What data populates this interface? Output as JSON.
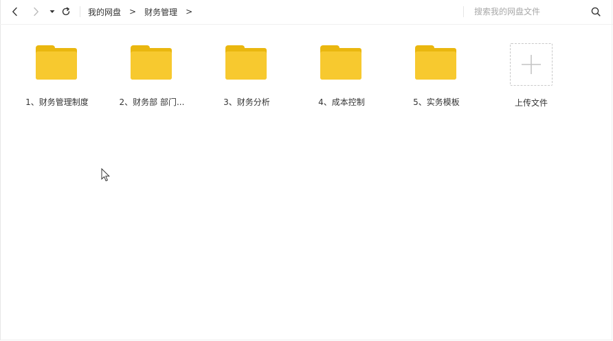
{
  "toolbar": {
    "icons": {
      "back": "chevron-left-icon",
      "forward": "chevron-right-icon",
      "dropdown": "caret-down-icon",
      "refresh": "refresh-icon",
      "search": "search-icon"
    },
    "breadcrumb": [
      {
        "label": "我的网盘"
      },
      {
        "label": "财务管理"
      }
    ],
    "breadcrumb_separator": ">",
    "search": {
      "placeholder": "搜索我的网盘文件",
      "value": ""
    }
  },
  "folders": [
    {
      "name": "1、财务管理制度"
    },
    {
      "name": "2、财务部 部门..."
    },
    {
      "name": "3、财务分析"
    },
    {
      "name": "4、成本控制"
    },
    {
      "name": "5、实务模板"
    }
  ],
  "upload": {
    "label": "上传文件",
    "icon": "plus-icon"
  },
  "colors": {
    "folder_front": "#f7c92f",
    "folder_back": "#eab70f",
    "text": "#333333",
    "placeholder": "#a8a8a8"
  }
}
